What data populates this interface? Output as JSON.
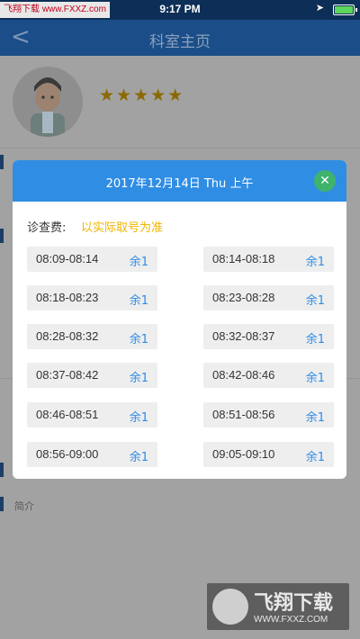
{
  "status_bar": {
    "carrier": "飞翔下载 www.FXXZ.com",
    "time": "9:17 PM"
  },
  "navbar": {
    "back": "<",
    "title": "科室主页"
  },
  "doctor": {
    "stars": "★★★★★",
    "intro": "简介"
  },
  "modal": {
    "title": "2017年12月14日  Thu  上午",
    "close": "✕",
    "fee_label": "诊查费:",
    "fee_value": "以实际取号为准",
    "slots": [
      {
        "time": "08:09-08:14",
        "remain": "余1"
      },
      {
        "time": "08:14-08:18",
        "remain": "余1"
      },
      {
        "time": "08:18-08:23",
        "remain": "余1"
      },
      {
        "time": "08:23-08:28",
        "remain": "余1"
      },
      {
        "time": "08:28-08:32",
        "remain": "余1"
      },
      {
        "time": "08:32-08:37",
        "remain": "余1"
      },
      {
        "time": "08:37-08:42",
        "remain": "余1"
      },
      {
        "time": "08:42-08:46",
        "remain": "余1"
      },
      {
        "time": "08:46-08:51",
        "remain": "余1"
      },
      {
        "time": "08:51-08:56",
        "remain": "余1"
      },
      {
        "time": "08:56-09:00",
        "remain": "余1"
      },
      {
        "time": "09:05-09:10",
        "remain": "余1"
      }
    ]
  },
  "watermark": {
    "text": "飞翔下载",
    "url": "WWW.FXXZ.COM"
  },
  "colors": {
    "header_blue": "#2f8de4",
    "fee_yellow": "#f0b400",
    "close_green": "#3fb36c"
  }
}
